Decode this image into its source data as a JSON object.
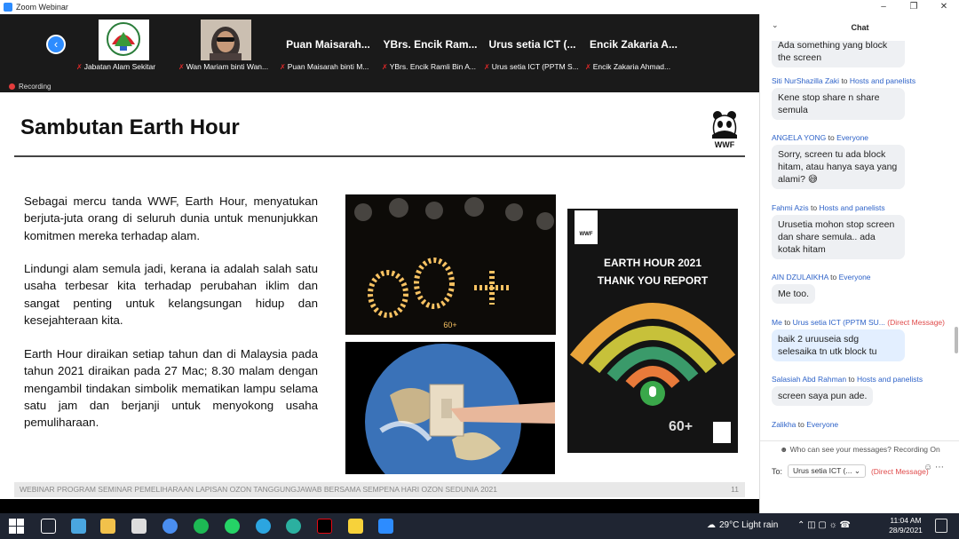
{
  "window": {
    "title": "Zoom Webinar"
  },
  "participants": [
    {
      "big": "",
      "name": "Jabatan Alam Sekitar"
    },
    {
      "big": "",
      "name": "Wan Mariam binti Wan..."
    },
    {
      "big": "Puan Maisarah...",
      "name": "Puan Maisarah binti M..."
    },
    {
      "big": "YBrs. Encik Ram...",
      "name": "YBrs. Encik Ramli Bin A..."
    },
    {
      "big": "Urus setia ICT (...",
      "name": "Urus setia ICT (PPTM S..."
    },
    {
      "big": "Encik Zakaria A...",
      "name": "Encik Zakaria Ahmad..."
    }
  ],
  "recording_label": "Recording",
  "slide": {
    "title": "Sambutan Earth Hour",
    "paragraphs": [
      "Sebagai mercu tanda WWF, Earth Hour, menyatukan berjuta-juta orang di seluruh dunia untuk menunjukkan komitmen mereka terhadap alam.",
      "Lindungi alam semula jadi, kerana ia adalah salah satu usaha terbesar kita terhadap perubahan iklim dan sangat penting untuk kelangsungan hidup dan kesejahteraan kita.",
      "Earth Hour diraikan setiap tahun dan di Malaysia pada tahun 2021 diraikan pada 27 Mac; 8.30 malam dengan mengambil tindakan simbolik mematikan lampu selama satu jam dan berjanji untuk menyokong usaha pemuliharaan."
    ],
    "poster_title_1": "EARTH HOUR 2021",
    "poster_title_2": "THANK YOU REPORT",
    "poster_badge": "60+",
    "poster_brand": "WWF",
    "candles_text": "60+",
    "footer": "WEBINAR PROGRAM SEMINAR PEMELIHARAAN LAPISAN OZON TANGGUNGJAWAB BERSAMA SEMPENA HARI OZON SEDUNIA 2021",
    "page": "11"
  },
  "chat": {
    "title": "Chat",
    "messages": [
      {
        "sender": "",
        "to": "",
        "recipient": "",
        "dm": "",
        "text": "Ada something yang block the screen"
      },
      {
        "sender": "Siti NurShazilla Zaki",
        "to": "to",
        "recipient": "Hosts and panelists",
        "dm": "",
        "text": "Kene stop share n share semula"
      },
      {
        "sender": "ANGELA YONG",
        "to": "to",
        "recipient": "Everyone",
        "dm": "",
        "text": "Sorry, screen tu ada block hitam, atau hanya saya yang alami? 😅"
      },
      {
        "sender": "Fahmi Azis",
        "to": "to",
        "recipient": "Hosts and panelists",
        "dm": "",
        "text": "Urusetia mohon stop screen dan share semula.. ada kotak hitam"
      },
      {
        "sender": "AIN DZULAIKHA",
        "to": "to",
        "recipient": "Everyone",
        "dm": "",
        "text": "Me too."
      },
      {
        "sender": "Me",
        "to": "to",
        "recipient": "Urus setia ICT (PPTM SU...",
        "dm": "(Direct Message)",
        "text": "baik 2 uruuseia sdg selesaika tn utk block tu"
      },
      {
        "sender": "Salasiah Abd Rahman",
        "to": "to",
        "recipient": "Hosts and panelists",
        "dm": "",
        "text": "screen saya pun ade."
      },
      {
        "sender": "Zalikha",
        "to": "to",
        "recipient": "Everyone",
        "dm": "",
        "text": ""
      }
    ],
    "privacy": "Who can see your messages? Recording On",
    "to_label": "To:",
    "to_value": "Urus setia ICT (...",
    "to_dm": "(Direct Message)"
  },
  "taskbar": {
    "weather": "29°C  Light rain",
    "time": "11:04 AM",
    "date": "28/9/2021"
  }
}
